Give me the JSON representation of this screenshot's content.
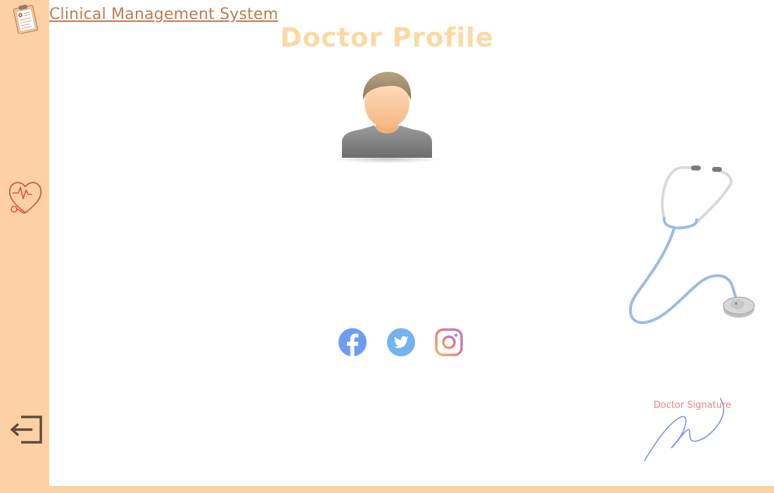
{
  "app": {
    "title": "Clinical Management System"
  },
  "page": {
    "title": "Doctor Profile"
  },
  "sidebar": {
    "items": [
      {
        "icon": "clipboard-icon"
      },
      {
        "icon": "heart-stethoscope-icon"
      },
      {
        "icon": "logout-icon"
      }
    ]
  },
  "social": {
    "items": [
      {
        "icon": "facebook-icon",
        "color": "#6d9cf3"
      },
      {
        "icon": "twitter-icon",
        "color": "#74b3ee"
      },
      {
        "icon": "instagram-icon",
        "color": "#e87a7a"
      }
    ]
  },
  "signature": {
    "label": "Doctor Signature"
  },
  "colors": {
    "sidebar": "#fdd1a3",
    "title_link": "#c07a4e",
    "heading": "#fcd9a4",
    "accent_red": "#e98580"
  }
}
